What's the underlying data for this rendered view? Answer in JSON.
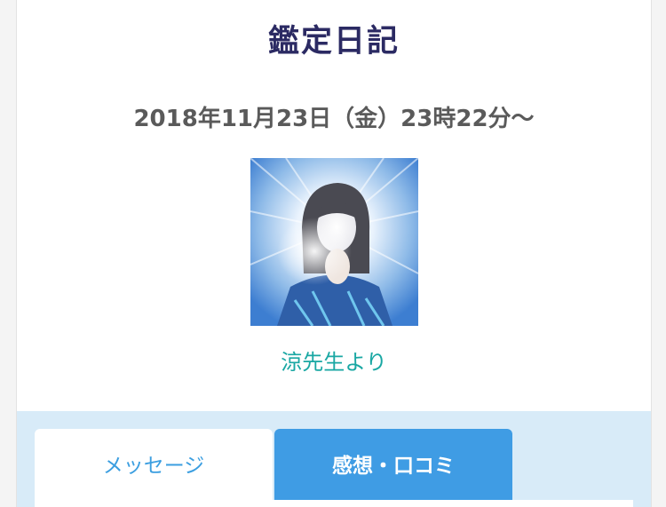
{
  "page": {
    "title": "鑑定日記",
    "datetime": "2018年11月23日（金）23時22分〜",
    "from_text": "涼先生より"
  },
  "tabs": [
    {
      "label": "メッセージ",
      "active": false
    },
    {
      "label": "感想・口コミ",
      "active": true
    }
  ],
  "colors": {
    "title": "#2b2a63",
    "datetime": "#5a5a5a",
    "from_text": "#19a7a3",
    "tab_area_bg": "#d8ebf8",
    "tab_active_bg": "#3f9ce4",
    "tab_inactive_text": "#3b9ee0"
  }
}
